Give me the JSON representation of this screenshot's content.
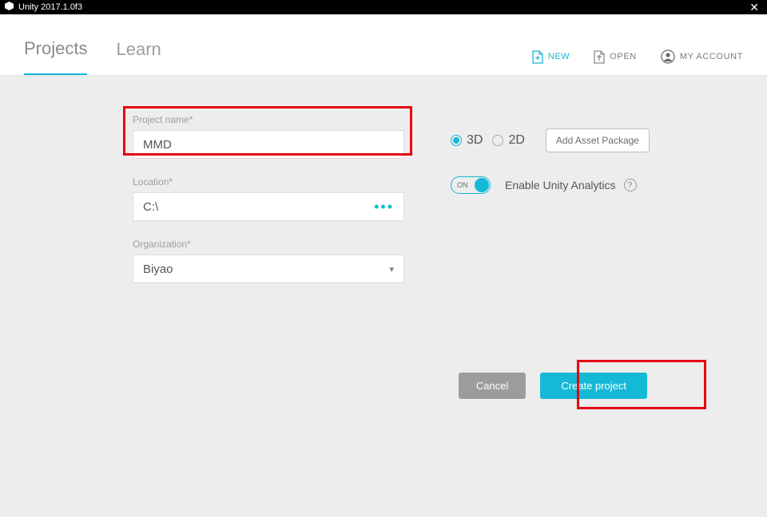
{
  "window": {
    "title": "Unity 2017.1.0f3"
  },
  "nav": {
    "tabs": {
      "projects": "Projects",
      "learn": "Learn"
    },
    "actions": {
      "new": "NEW",
      "open": "OPEN",
      "account": "MY ACCOUNT"
    }
  },
  "form": {
    "projectName": {
      "label": "Project name*",
      "value": "MMD"
    },
    "location": {
      "label": "Location*",
      "value": "C:\\"
    },
    "organization": {
      "label": "Organization*",
      "value": "Biyao"
    }
  },
  "dimensions": {
    "threeD": "3D",
    "twoD": "2D",
    "selected": "3D"
  },
  "assetButton": "Add Asset Package",
  "analytics": {
    "toggle": "ON",
    "label": "Enable Unity Analytics",
    "help": "?"
  },
  "buttons": {
    "cancel": "Cancel",
    "create": "Create project"
  }
}
